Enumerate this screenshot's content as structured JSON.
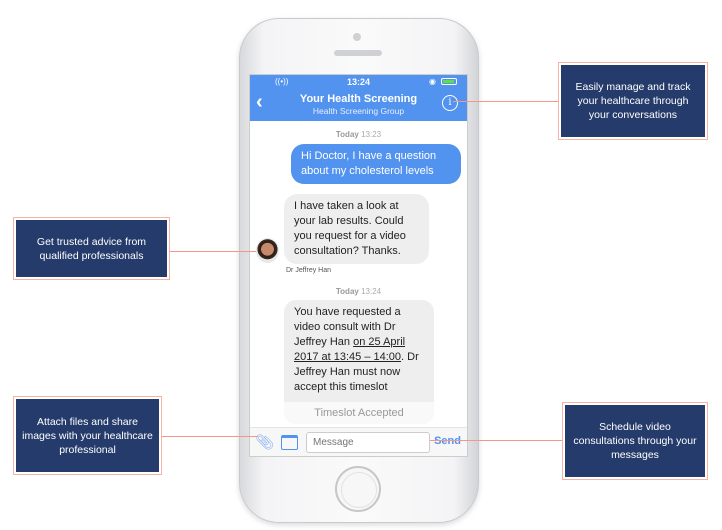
{
  "status_bar": {
    "time": "13:24"
  },
  "header": {
    "title": "Your Health Screening",
    "subtitle": "Health Screening Group",
    "back_icon": "chevron-left-icon",
    "info_icon": "info-icon"
  },
  "conversation": {
    "timestamp1": {
      "day": "Today",
      "time": "13:23"
    },
    "outgoing": "Hi Doctor, I have a question about my cholesterol levels",
    "incoming": "I have taken a look at your lab results. Could you request for a video consultation? Thanks.",
    "sender": "Dr Jeffrey Han",
    "timestamp2": {
      "day": "Today",
      "time": "13:24"
    },
    "request": {
      "text_before": "You have requested a video consult with Dr Jeffrey Han ",
      "link": "on 25 April 2017 at 13:45 – 14:00",
      "text_after": ". Dr Jeffrey Han must now accept this timeslot",
      "status": "Timeslot Accepted"
    }
  },
  "composer": {
    "placeholder": "Message",
    "send_label": "Send",
    "attach_icon": "paperclip-icon",
    "calendar_icon": "calendar-icon"
  },
  "callouts": {
    "manage": "Easily manage and track your healthcare through your conversations",
    "advice": "Get trusted advice from qualified professionals",
    "attach": "Attach files and share images with your healthcare professional",
    "schedule": "Schedule video consultations through your messages"
  },
  "colors": {
    "accent": "#5293f0",
    "callout": "#253b6b",
    "connector": "#f3978a"
  }
}
